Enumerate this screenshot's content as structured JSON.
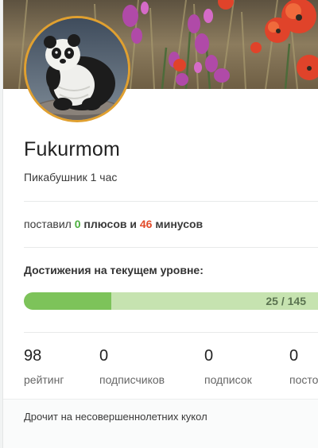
{
  "profile": {
    "username": "Fukurmom",
    "rank": "Пикабушник 1 час",
    "avatar_alt": "panda-avatar"
  },
  "votes": {
    "prefix": "поставил",
    "plus_count": "0",
    "plus_label": "плюсов",
    "conjunction": "и",
    "minus_count": "46",
    "minus_label": "минусов"
  },
  "achievements": {
    "title": "Достижения на текущем уровне:",
    "progress_text": "25 / 145",
    "progress_fraction": 0.297
  },
  "stats": [
    {
      "value": "98",
      "label": "рейтинг"
    },
    {
      "value": "0",
      "label": "подписчиков"
    },
    {
      "value": "0",
      "label": "подписок"
    },
    {
      "value": "0",
      "label": "посто"
    }
  ],
  "bio": "Дрочит на несовершеннолетних кукол",
  "colors": {
    "plus": "#4caf3e",
    "minus": "#e24b2a",
    "progress_fill": "#7dc35a",
    "progress_track": "#c6e3b0",
    "avatar_border": "#e0a030"
  }
}
